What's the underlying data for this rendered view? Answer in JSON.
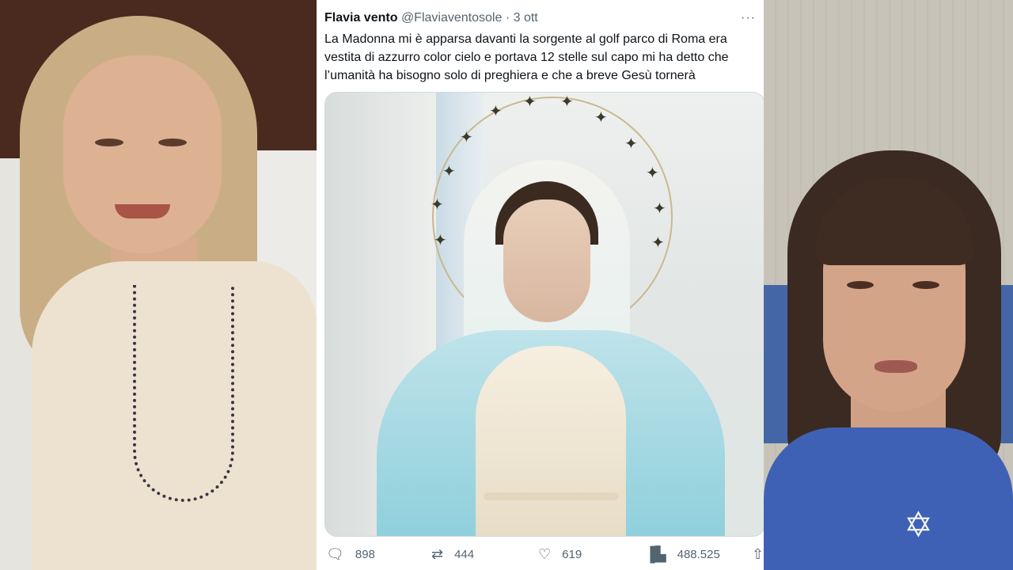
{
  "tweet": {
    "author_name": "Flavia vento",
    "author_handle": "@Flaviaventosole",
    "separator": "·",
    "date": "3 ott",
    "more_icon": "···",
    "text": "La Madonna mi è apparsa davanti la sorgente al golf parco di Roma era vestita di azzurro color cielo e portava 12 stelle sul capo mi ha detto che l’umanità ha bisogno solo di preghiera e che a breve Gesù tornerà",
    "image_description": "statue-of-virgin-mary-with-12-star-halo",
    "actions": {
      "replies": {
        "icon": "reply-icon",
        "count": "898"
      },
      "retweets": {
        "icon": "retweet-icon",
        "count": "444"
      },
      "likes": {
        "icon": "heart-icon",
        "count": "619"
      },
      "views": {
        "icon": "views-bar-chart-icon",
        "count": "488.525"
      },
      "share": {
        "icon": "share-icon"
      }
    }
  },
  "video_feeds": {
    "left": {
      "participant": "woman-with-blonde-hair-and-earphones"
    },
    "right": {
      "participant": "woman-with-dark-hair-in-blue-top"
    }
  },
  "colors": {
    "text_primary": "#0f1419",
    "text_secondary": "#536471",
    "card_background": "#ffffff",
    "mantle_blue": "#bfe3ea"
  }
}
